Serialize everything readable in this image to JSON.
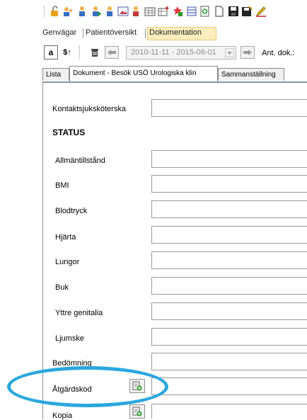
{
  "toolbar_icons": [
    "unlock-icon",
    "patients-icon",
    "person-icon",
    "person-add-icon",
    "person-search-icon",
    "image-icon",
    "person-edit-icon",
    "grid-icon",
    "grid-add-icon",
    "star-grid-icon",
    "table-icon",
    "refresh-icon",
    "blank-page-icon",
    "save-icon",
    "save-alt-icon",
    "pen-icon"
  ],
  "menu": {
    "items": [
      "Genvägar",
      "Patientöversikt",
      "Dokumentation"
    ],
    "active": "Dokumentation"
  },
  "toolbar2": {
    "btn_a_label": "a",
    "btn_sort_label": "$↑",
    "date_range": "2010-11-11 - 2015-06-01",
    "ant_dok_label": "Ant. dok.:"
  },
  "tabs": [
    "Lista",
    "Dokument - Besök USÖ Urologiska klin",
    "Sammanställning"
  ],
  "form": {
    "kontakt_label": "Kontaktsjuksköterska",
    "status_heading": "STATUS",
    "status_fields": [
      "Allmäntillstånd",
      "BMI",
      "Blodtryck",
      "Hjärta",
      "Lungor",
      "Buk",
      "Yttre genitalia",
      "Ljumske"
    ],
    "bedomning_label": "Bedömning",
    "atgardskod_label": "Åtgärdskod",
    "kopia_label": "Kopia"
  },
  "colors": {
    "highlight_ellipse": "#2aa7df",
    "active_menu_bg": "#fbeebe"
  }
}
